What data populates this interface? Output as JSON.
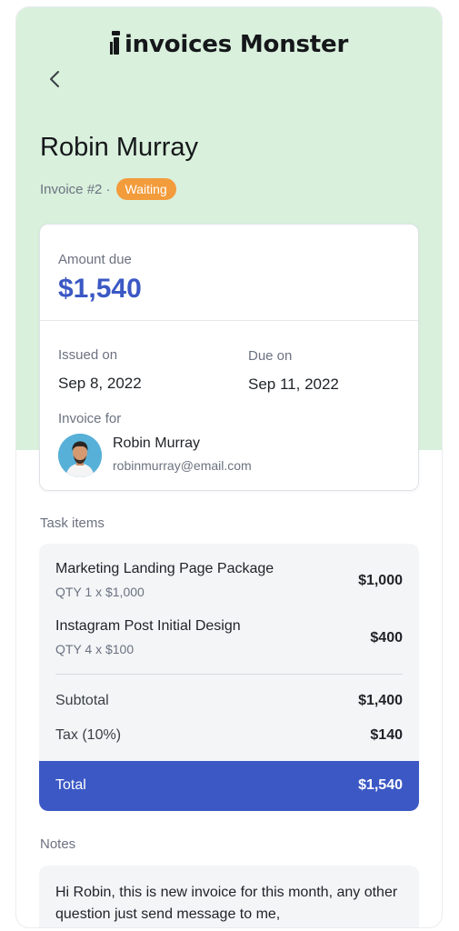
{
  "app": {
    "brand": "invoices Monster"
  },
  "header": {
    "back_icon": "chevron-left-icon",
    "client_name": "Robin Murray",
    "invoice_number": "Invoice #2 ·",
    "status": "Waiting",
    "status_color": "#f39c3c",
    "hero_color": "#d9f0dc"
  },
  "summary": {
    "amount_label": "Amount due",
    "amount": "$1,540",
    "issued_label": "Issued on",
    "issued_date": "Sep 8, 2022",
    "due_label": "Due on",
    "due_date": "Sep 11, 2022",
    "invoice_for_label": "Invoice for",
    "recipient_name": "Robin Murray",
    "recipient_email": "robinmurray@email.com"
  },
  "tasks": {
    "section_label": "Task items",
    "items": [
      {
        "title": "Marketing Landing Page Package",
        "qty": "QTY 1 x $1,000",
        "price": "$1,000"
      },
      {
        "title": "Instagram Post Initial Design",
        "qty": "QTY 4 x $100",
        "price": "$400"
      }
    ],
    "subtotal_label": "Subtotal",
    "subtotal": "$1,400",
    "tax_label": "Tax (10%)",
    "tax": "$140",
    "total_label": "Total",
    "total": "$1,540",
    "accent_color": "#3b58c4"
  },
  "notes": {
    "section_label": "Notes",
    "text": "Hi Robin, this is new invoice for this month, any other question just send message to me,"
  }
}
